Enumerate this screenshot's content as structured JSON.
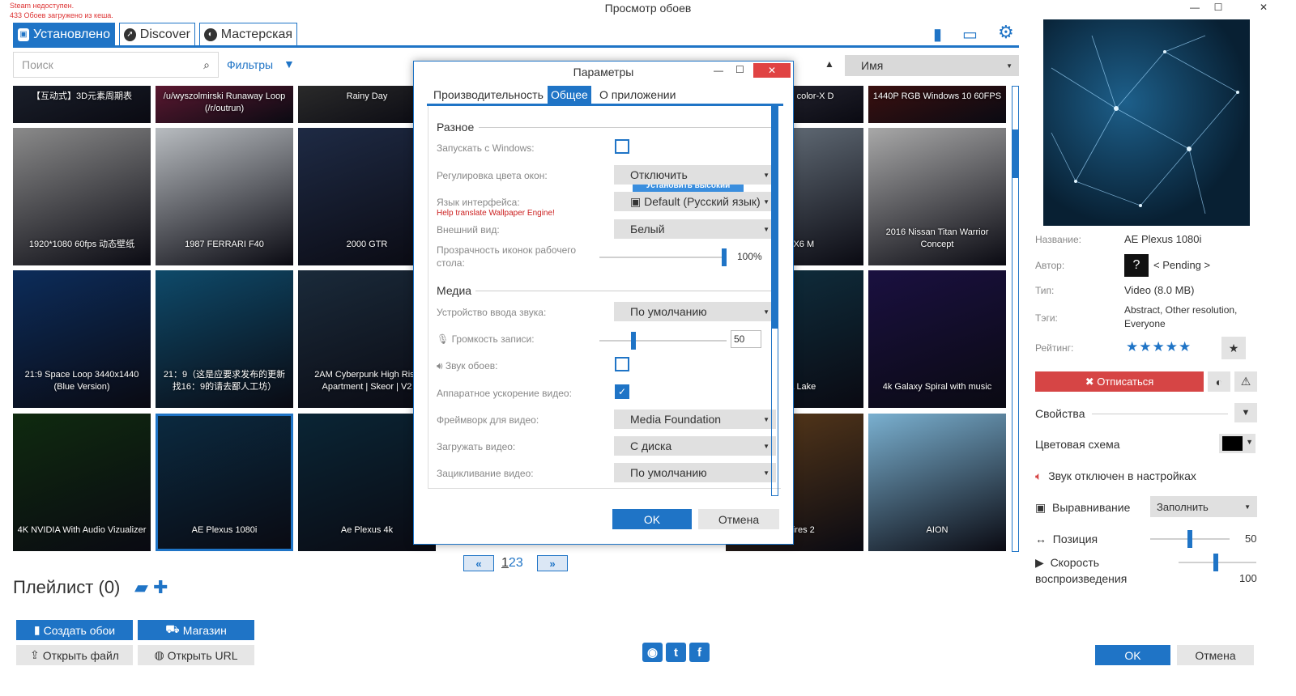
{
  "window": {
    "title": "Просмотр обоев",
    "minimize": "—",
    "maximize": "☐",
    "close": "✕"
  },
  "status": {
    "line1": "Steam недоступен.",
    "line2": "433 Обоев загружено из кеша."
  },
  "tabs": [
    {
      "label": "Установлено"
    },
    {
      "label": "Discover"
    },
    {
      "label": "Мастерская"
    }
  ],
  "search": {
    "placeholder": "Поиск"
  },
  "filters_label": "Фильтры",
  "sort": {
    "value": "Имя"
  },
  "tiles": [
    {
      "label": "【互动式】3D元素周期表",
      "bg": "#1a1f2a"
    },
    {
      "label": "/u/wyszolmirski Runaway Loop (/r/outrun)",
      "bg": "#5a1830"
    },
    {
      "label": "Rainy Day",
      "bg": "#2a2a2a"
    },
    {
      "label": "1920*1080 60fps 动态壁纸",
      "bg": "#8a8a8a"
    },
    {
      "label": "1987 FERRARI F40",
      "bg": "#b8bcc0"
    },
    {
      "label": "2000 GTR",
      "bg": "#1e2a44"
    },
    {
      "label": "21:9 Space Loop 3440x1440 (Blue Version)",
      "bg": "#0c2c5a"
    },
    {
      "label": "21：9（这是应要求发布的更新 找16：9的请去鄙人工坊）",
      "bg": "#0e4a6a"
    },
    {
      "label": "2AM Cyberpunk High Rise Apartment | Skeor | V2",
      "bg": "#1a2a3a"
    },
    {
      "label": "4K NVIDIA With Audio Vizualizer",
      "bg": "#0f2a0f"
    },
    {
      "label": "AE Plexus 1080i",
      "bg": "#0b2a40"
    },
    {
      "label": "Ae Plexus 4k",
      "bg": "#0a2535"
    },
    {
      "label": "ne miku + color-X D",
      "bg": "#2a2a36"
    },
    {
      "label": "1440P RGB Windows 10 60FPS",
      "bg": "#3a1010"
    },
    {
      "label": "MW X6 M",
      "bg": "#6a7580"
    },
    {
      "label": "2016 Nissan Titan Warrior Concept",
      "bg": "#a8a8a8"
    },
    {
      "label": "urora Lake",
      "bg": "#0f3040"
    },
    {
      "label": "4k Galaxy Spiral with music",
      "bg": "#1a1040"
    },
    {
      "label": "Empires 2",
      "bg": "#5a3a1a"
    },
    {
      "label": "AION",
      "bg": "#7ab0d0"
    }
  ],
  "pager": {
    "prev": "«",
    "next": "»",
    "p1": "1",
    "p2": "2",
    "p3": "3"
  },
  "playlist": {
    "title": "Плейлист (0)"
  },
  "buttons": {
    "create": "Создать обои",
    "shop": "Магазин",
    "open_file": "Открыть файл",
    "open_url": "Открыть URL",
    "ok": "OK",
    "cancel": "Отмена"
  },
  "details": {
    "name_label": "Название:",
    "name": "AE Plexus 1080i",
    "author_label": "Автор:",
    "author": "< Pending >",
    "author_badge": "?",
    "type_label": "Тип:",
    "type": "Video (8.0 MB)",
    "tags_label": "Тэги:",
    "tags1": "Abstract, Other resolution,",
    "tags2": "Everyone",
    "rating_label": "Рейтинг:",
    "stars": "★★★★★",
    "rating": 5,
    "unsubscribe": "Отписаться"
  },
  "properties": {
    "title": "Свойства",
    "color_scheme": "Цветовая схема",
    "sound_off": "Звук отключен в настройках",
    "align_label": "Выравнивание",
    "align_value": "Заполнить",
    "position_label": "Позиция",
    "position_value": "50",
    "speed_label1": "Скорость",
    "speed_label2": "воспроизведения",
    "speed_value": "100"
  },
  "dialog": {
    "title": "Параметры",
    "tabs": [
      "Производительность",
      "Общее",
      "О приложении"
    ],
    "misc": "Разное",
    "startup": "Запускать с Windows:",
    "priority": "Установить высокий приоритет",
    "window_color": "Регулировка цвета окон:",
    "window_color_value": "Отключить",
    "lang": "Язык интерфейса:",
    "lang_help": "Help translate Wallpaper Engine!",
    "lang_value": "Default (Русский язык)",
    "appearance": "Внешний вид:",
    "appearance_value": "Белый",
    "icon_opacity1": "Прозрачность иконок рабочего",
    "icon_opacity2": "стола:",
    "icon_opacity_value": "100%",
    "media": "Медиа",
    "audio_in": "Устройство ввода звука:",
    "audio_in_value": "По умолчанию",
    "rec_volume": "Громкость записи:",
    "rec_volume_value": "50",
    "wall_sound": "Звук обоев:",
    "hw_accel": "Аппаратное ускорение видео:",
    "framework": "Фреймворк для видео:",
    "framework_value": "Media Foundation",
    "load_video": "Загружать видео:",
    "load_video_value": "С диска",
    "loop": "Зацикливание видео:",
    "loop_value": "По умолчанию",
    "ok": "OK",
    "cancel": "Отмена"
  }
}
